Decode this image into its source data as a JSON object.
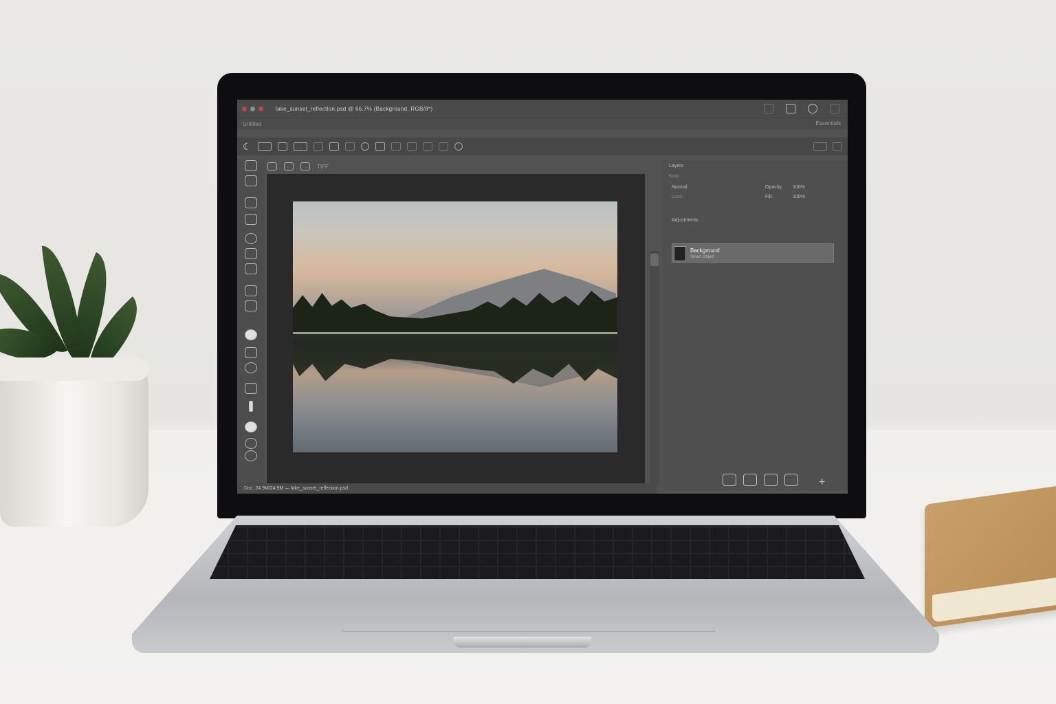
{
  "scene": {
    "colors": {
      "wall": "#e7e6e2",
      "desk": "#f1f0ee",
      "laptop_silver": "#c0c2c6",
      "notebook": "#c49a64",
      "plant": "#2c4524"
    }
  },
  "app": {
    "theme": "dark",
    "window_title": "lake_sunset_reflection.psd @ 66.7% (Background, RGB/8*)",
    "menu_left": "Untitled",
    "menu_right": "Essentials",
    "options_icons": [
      "moon-icon",
      "marquee-icon",
      "crop-icon",
      "frame-icon",
      "link-icon",
      "wand-icon",
      "brush-icon",
      "clone-icon",
      "gradient-icon",
      "text-icon",
      "settings-icon"
    ],
    "tools": [
      "move-tool-icon",
      "marquee-tool-icon",
      "lasso-tool-icon",
      "brush-tool-icon",
      "eraser-tool-icon",
      "stamp-tool-icon",
      "crop-tool-icon",
      "eyedropper-tool-icon",
      "healing-tool-icon",
      "circle-selected-tool-icon",
      "gradient-tool-icon",
      "blur-tool-icon",
      "hand-tool-icon",
      "pen-tool-icon",
      "zoom-tool-icon",
      "foreground-color-icon",
      "quick-mask-icon"
    ],
    "doc_tab": "TIFF",
    "canvas": {
      "image": "lake at dusk with forest and mountain reflection"
    },
    "panel": {
      "title": "Layers",
      "filter_label": "Kind",
      "blend_mode": "Normal",
      "opacity_label": "Opacity:",
      "opacity_value": "100%",
      "lock_label": "Lock:",
      "fill_label": "Fill:",
      "fill_value": "100%",
      "group_label": "Adjustments",
      "layer_name": "Background",
      "layer_sub": "Smart Object"
    },
    "status_text": "Doc: 24.9M/24.9M  — lake_sunset_reflection.psd"
  }
}
